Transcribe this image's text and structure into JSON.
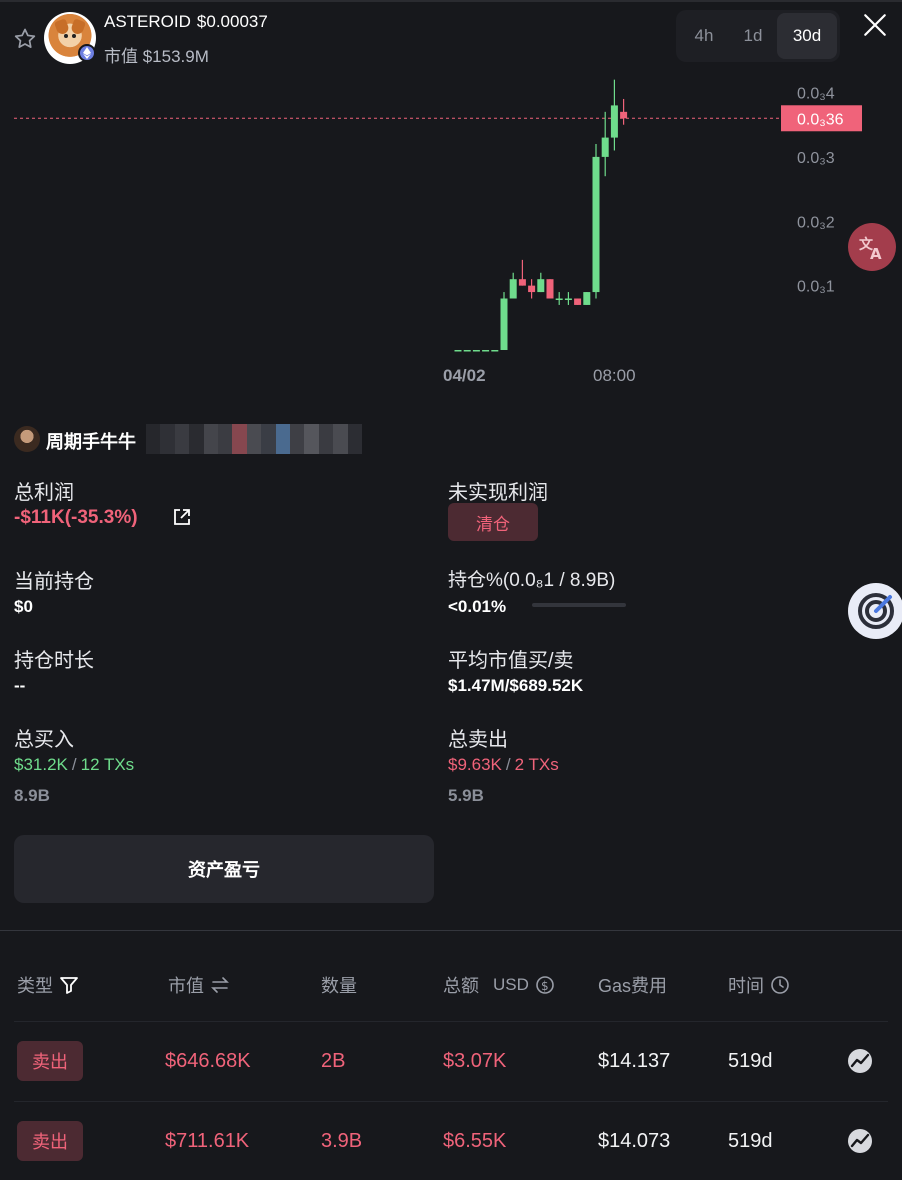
{
  "header": {
    "token_name": "ASTEROID",
    "token_price": "$0.00037",
    "market_cap": "市值 $153.9M",
    "icons": [
      "star-icon",
      "ethereum-icon",
      "close-icon"
    ]
  },
  "timeframes": [
    {
      "label": "4h",
      "active": false
    },
    {
      "label": "1d",
      "active": false
    },
    {
      "label": "30d",
      "active": true
    }
  ],
  "chart_data": {
    "type": "candlestick",
    "x_tick_labels": [
      "04/02",
      "08:00"
    ],
    "y_tick_labels": [
      "0.0₃4",
      "0.0₃3",
      "0.0₃2",
      "0.0₃1"
    ],
    "y_ticks": [
      0.0004,
      0.0003,
      0.0002,
      0.0001
    ],
    "ylim": [
      0.0,
      0.000435
    ],
    "current_price_label": "0.0₃36",
    "current_price": 0.00036,
    "candles": [
      {
        "o": 0.0,
        "c": 0.0,
        "h": 0.0,
        "l": 0.0
      },
      {
        "o": 0.0,
        "c": 0.0,
        "h": 0.0,
        "l": 0.0
      },
      {
        "o": 0.0,
        "c": 0.0,
        "h": 0.0,
        "l": 0.0
      },
      {
        "o": 0.0,
        "c": 0.0,
        "h": 0.0,
        "l": 0.0
      },
      {
        "o": 0.0,
        "c": 0.0,
        "h": 0.0,
        "l": 0.0
      },
      {
        "o": 0.0,
        "c": 8e-05,
        "h": 9e-05,
        "l": 0.0
      },
      {
        "o": 8e-05,
        "c": 0.00011,
        "h": 0.00012,
        "l": 8e-05
      },
      {
        "o": 0.00011,
        "c": 0.0001,
        "h": 0.00014,
        "l": 0.0001
      },
      {
        "o": 0.0001,
        "c": 9e-05,
        "h": 0.00011,
        "l": 8e-05
      },
      {
        "o": 9e-05,
        "c": 0.00011,
        "h": 0.00012,
        "l": 9e-05
      },
      {
        "o": 0.00011,
        "c": 8e-05,
        "h": 0.00011,
        "l": 8e-05
      },
      {
        "o": 8e-05,
        "c": 8e-05,
        "h": 9e-05,
        "l": 7e-05
      },
      {
        "o": 8e-05,
        "c": 8e-05,
        "h": 9e-05,
        "l": 7e-05
      },
      {
        "o": 8e-05,
        "c": 7e-05,
        "h": 8e-05,
        "l": 7e-05
      },
      {
        "o": 7e-05,
        "c": 9e-05,
        "h": 9e-05,
        "l": 7e-05
      },
      {
        "o": 9e-05,
        "c": 0.0003,
        "h": 0.00032,
        "l": 8e-05
      },
      {
        "o": 0.0003,
        "c": 0.00033,
        "h": 0.00037,
        "l": 0.00027
      },
      {
        "o": 0.00033,
        "c": 0.00038,
        "h": 0.00042,
        "l": 0.00031
      },
      {
        "o": 0.00037,
        "c": 0.00036,
        "h": 0.00039,
        "l": 0.00035
      }
    ]
  },
  "user": {
    "name": "周期手牛牛"
  },
  "stats": {
    "total_profit_label": "总利润",
    "total_profit_value": "-$11K(-35.3%)",
    "unrealized_label": "未实现利润",
    "close_position_label": "清仓",
    "current_holding_label": "当前持仓",
    "current_holding_value": "$0",
    "holding_pct_label": "持仓%(0.0₈1 / 8.9B)",
    "holding_pct_value": "<0.01%",
    "holding_pct_fraction": 0.0,
    "holding_duration_label": "持仓时长",
    "holding_duration_value": "--",
    "avg_mcap_label": "平均市值买/卖",
    "avg_mcap_value": "$1.47M/$689.52K",
    "total_buy_label": "总买入",
    "total_buy_amount": "$31.2K",
    "total_buy_txs": "12 TXs",
    "total_buy_tokens": "8.9B",
    "total_sell_label": "总卖出",
    "total_sell_amount": "$9.63K",
    "total_sell_txs": "2 TXs",
    "total_sell_tokens": "5.9B",
    "separator": "/"
  },
  "pnl_button": "资产盈亏",
  "table": {
    "headers": {
      "type": "类型",
      "mcap": "市值",
      "quantity": "数量",
      "total": "总额",
      "total_unit": "USD",
      "gas": "Gas费用",
      "time": "时间"
    },
    "rows": [
      {
        "type": "卖出",
        "mcap": "$646.68K",
        "quantity": "2B",
        "total": "$3.07K",
        "gas": "$14.137",
        "time": "519d"
      },
      {
        "type": "卖出",
        "mcap": "$711.61K",
        "quantity": "3.9B",
        "total": "$6.55K",
        "gas": "$14.073",
        "time": "519d"
      }
    ]
  },
  "colors": {
    "background": "#17181c",
    "up": "#6fdc8c",
    "down": "#f0637a",
    "price_tag": "#f0637a"
  }
}
